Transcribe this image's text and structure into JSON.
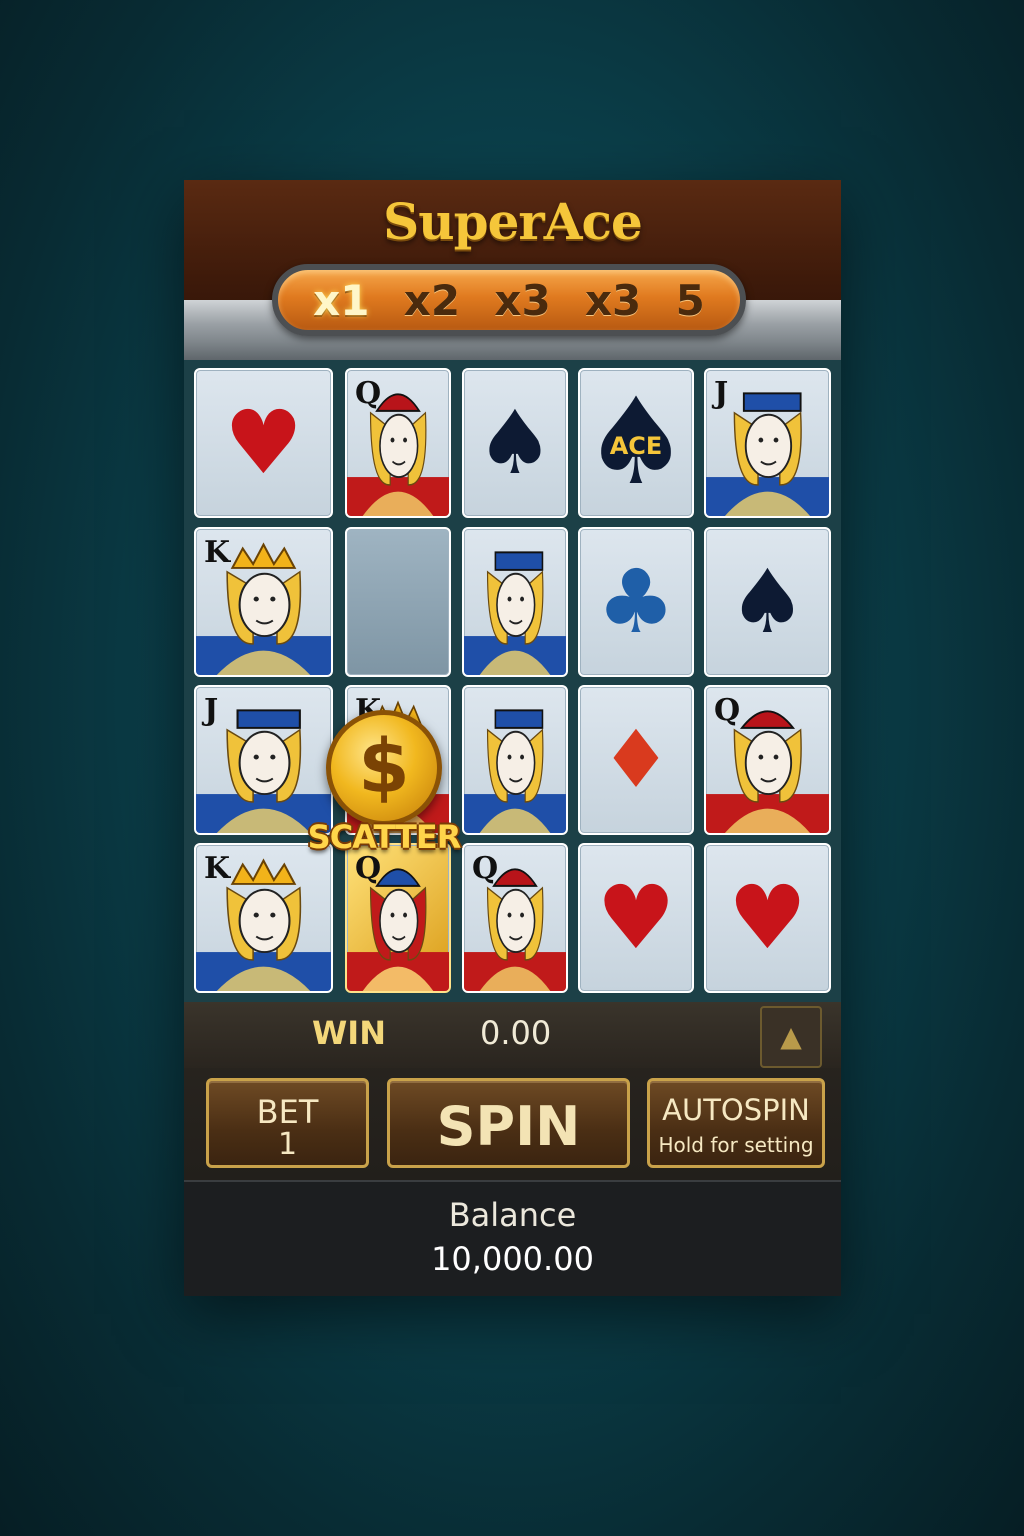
{
  "game": {
    "title": "SuperAce",
    "multipliers": [
      {
        "label": "x1",
        "active": true
      },
      {
        "label": "x2",
        "active": false
      },
      {
        "label": "x3",
        "active": false
      },
      {
        "label": "x3",
        "active": false
      },
      {
        "label": "5",
        "active": false
      }
    ]
  },
  "reels": {
    "rows": [
      [
        {
          "kind": "suit",
          "symbol": "heart",
          "glyph": "♥",
          "color": "red"
        },
        {
          "kind": "face",
          "symbol": "queen",
          "corner": "Q",
          "palette": "red"
        },
        {
          "kind": "suit",
          "symbol": "spade",
          "glyph": "♠",
          "color": "black"
        },
        {
          "kind": "ace",
          "symbol": "ace",
          "label": "ACE"
        },
        {
          "kind": "face",
          "symbol": "jack",
          "corner": "J",
          "palette": "blue"
        }
      ],
      [
        {
          "kind": "face",
          "symbol": "king",
          "corner": "K",
          "palette": "blue"
        },
        {
          "kind": "scatter",
          "symbol": "scatter"
        },
        {
          "kind": "face",
          "symbol": "jack",
          "corner": "",
          "palette": "blue"
        },
        {
          "kind": "suit",
          "symbol": "club",
          "glyph": "♣",
          "color": "blue"
        },
        {
          "kind": "suit",
          "symbol": "spade",
          "glyph": "♠",
          "color": "black"
        }
      ],
      [
        {
          "kind": "face",
          "symbol": "jack",
          "corner": "J",
          "palette": "blue"
        },
        {
          "kind": "face",
          "symbol": "king",
          "corner": "K",
          "palette": "red"
        },
        {
          "kind": "face",
          "symbol": "jack",
          "corner": "",
          "palette": "blue"
        },
        {
          "kind": "suit",
          "symbol": "diamond",
          "glyph": "♦",
          "color": "diamond"
        },
        {
          "kind": "face",
          "symbol": "queen",
          "corner": "Q",
          "palette": "red"
        }
      ],
      [
        {
          "kind": "face",
          "symbol": "king",
          "corner": "K",
          "palette": "blue"
        },
        {
          "kind": "face",
          "symbol": "queen",
          "corner": "Q",
          "palette": "gold"
        },
        {
          "kind": "face",
          "symbol": "queen",
          "corner": "Q",
          "palette": "red"
        },
        {
          "kind": "suit",
          "symbol": "heart",
          "glyph": "♥",
          "color": "red"
        },
        {
          "kind": "suit",
          "symbol": "heart",
          "glyph": "♥",
          "color": "red"
        }
      ]
    ],
    "scatter": {
      "label": "SCATTER",
      "glyph": "$"
    }
  },
  "controls": {
    "win_label": "WIN",
    "win_value": "0.00",
    "up_icon": "▲",
    "bet_label": "BET",
    "bet_value": "1",
    "spin_label": "SPIN",
    "autospin_label": "AUTOSPIN",
    "autospin_hint": "Hold for setting"
  },
  "balance": {
    "label": "Balance",
    "value": "10,000.00"
  },
  "colors": {
    "accent_gold": "#f5c63a",
    "button_border": "#c9a24a",
    "heart_red": "#c8141a",
    "club_blue": "#1f5fa8"
  }
}
